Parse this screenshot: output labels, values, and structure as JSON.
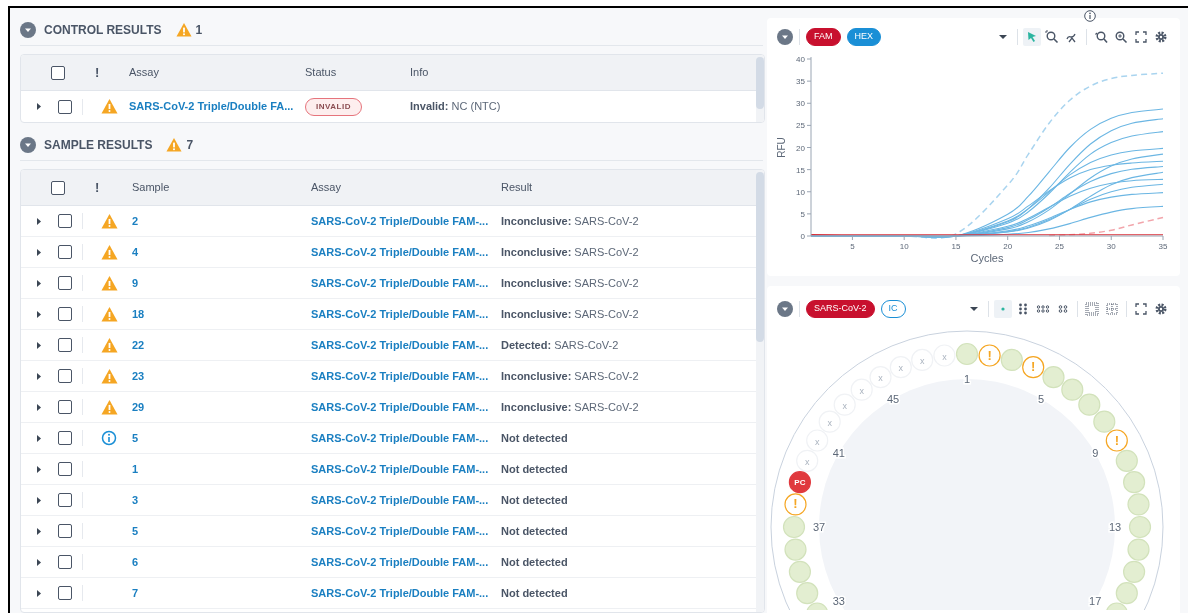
{
  "control_results": {
    "title": "CONTROL RESULTS",
    "warning_count": "1",
    "expanded": true,
    "columns": [
      "Assay",
      "Status",
      "Info"
    ],
    "flag_header": "!",
    "header_checked": false,
    "rows": [
      {
        "expanded": false,
        "checked": false,
        "kind": "warning",
        "assay": "SARS-CoV-2 Triple/Double FA...",
        "status": "INVALID",
        "info_label": "Invalid:",
        "info_detail": "NC (NTC)"
      }
    ]
  },
  "sample_results": {
    "title": "SAMPLE RESULTS",
    "warning_count": "7",
    "expanded": true,
    "columns": [
      "Sample",
      "Assay",
      "Result"
    ],
    "flag_header": "!",
    "header_checked": false,
    "rows": [
      {
        "expanded": false,
        "checked": false,
        "kind": "warning",
        "sample": "2",
        "assay": "SARS-CoV-2 Triple/Double FAM-...",
        "result_label": "Inconclusive:",
        "result_detail": "SARS-CoV-2"
      },
      {
        "expanded": false,
        "checked": false,
        "kind": "warning",
        "sample": "4",
        "assay": "SARS-CoV-2 Triple/Double FAM-...",
        "result_label": "Inconclusive:",
        "result_detail": "SARS-CoV-2"
      },
      {
        "expanded": false,
        "checked": false,
        "kind": "warning",
        "sample": "9",
        "assay": "SARS-CoV-2 Triple/Double FAM-...",
        "result_label": "Inconclusive:",
        "result_detail": "SARS-CoV-2"
      },
      {
        "expanded": false,
        "checked": false,
        "kind": "warning",
        "sample": "18",
        "assay": "SARS-CoV-2 Triple/Double FAM-...",
        "result_label": "Inconclusive:",
        "result_detail": "SARS-CoV-2"
      },
      {
        "expanded": false,
        "checked": false,
        "kind": "warning",
        "sample": "22",
        "assay": "SARS-CoV-2 Triple/Double FAM-...",
        "result_label": "Detected:",
        "result_detail": "SARS-CoV-2"
      },
      {
        "expanded": false,
        "checked": false,
        "kind": "warning",
        "sample": "23",
        "assay": "SARS-CoV-2 Triple/Double FAM-...",
        "result_label": "Inconclusive:",
        "result_detail": "SARS-CoV-2"
      },
      {
        "expanded": false,
        "checked": false,
        "kind": "warning",
        "sample": "29",
        "assay": "SARS-CoV-2 Triple/Double FAM-...",
        "result_label": "Inconclusive:",
        "result_detail": "SARS-CoV-2"
      },
      {
        "expanded": false,
        "checked": false,
        "kind": "info",
        "sample": "5",
        "assay": "SARS-CoV-2 Triple/Double FAM-...",
        "result_label": "Not detected"
      },
      {
        "expanded": false,
        "checked": false,
        "kind": "plain",
        "sample": "1",
        "assay": "SARS-CoV-2 Triple/Double FAM-...",
        "result_label": "Not detected"
      },
      {
        "expanded": false,
        "checked": false,
        "kind": "plain",
        "sample": "3",
        "assay": "SARS-CoV-2 Triple/Double FAM-...",
        "result_label": "Not detected"
      },
      {
        "expanded": false,
        "checked": false,
        "kind": "plain",
        "sample": "5",
        "assay": "SARS-CoV-2 Triple/Double FAM-...",
        "result_label": "Not detected"
      },
      {
        "expanded": false,
        "checked": false,
        "kind": "plain",
        "sample": "6",
        "assay": "SARS-CoV-2 Triple/Double FAM-...",
        "result_label": "Not detected"
      },
      {
        "expanded": false,
        "checked": false,
        "kind": "plain",
        "sample": "7",
        "assay": "SARS-CoV-2 Triple/Double FAM-...",
        "result_label": "Not detected"
      }
    ]
  },
  "amplification": {
    "expanded": true,
    "channels": [
      {
        "label": "FAM",
        "selected": true,
        "color": "#c8102e"
      },
      {
        "label": "HEX",
        "selected": true,
        "color": "#1a8fd6"
      }
    ],
    "chart_data": {
      "type": "line",
      "xlabel": "Cycles",
      "ylabel": "RFU",
      "xlim": [
        1,
        35
      ],
      "ylim": [
        0,
        40
      ],
      "xticks": [
        5,
        10,
        15,
        20,
        25,
        30,
        35
      ],
      "yticks": [
        0,
        5,
        10,
        15,
        20,
        25,
        30,
        35,
        40
      ],
      "x": [
        1,
        5,
        10,
        15,
        20,
        22,
        24,
        26,
        28,
        30,
        32,
        35
      ],
      "series": [
        {
          "color": "#a9d4ef",
          "line_style": "dashed",
          "values": [
            0,
            0,
            0,
            0.5,
            11.5,
            18.5,
            25.5,
            30.7,
            33.9,
            35.6,
            36.3,
            36.8
          ]
        },
        {
          "color": "#6bb6e3",
          "line_style": "solid",
          "values": [
            0,
            0,
            0,
            0,
            4.9,
            9.0,
            14.5,
            20.0,
            24.1,
            26.6,
            27.9,
            28.7
          ]
        },
        {
          "color": "#6bb6e3",
          "line_style": "solid",
          "values": [
            0,
            0,
            0,
            0,
            3.2,
            6.2,
            10.8,
            16.2,
            20.8,
            23.8,
            25.5,
            26.5
          ]
        },
        {
          "color": "#6bb6e3",
          "line_style": "solid",
          "values": [
            0,
            0,
            0,
            0,
            2.9,
            5.5,
            9.6,
            14.4,
            18.5,
            21.1,
            22.6,
            23.6
          ]
        },
        {
          "color": "#6bb6e3",
          "line_style": "solid",
          "values": [
            0,
            0,
            0,
            0,
            3.4,
            6.2,
            10.0,
            13.8,
            16.6,
            18.3,
            19.2,
            19.8
          ]
        },
        {
          "color": "#6bb6e3",
          "line_style": "solid",
          "values": [
            0,
            0,
            0,
            0,
            1.6,
            3.2,
            5.9,
            9.5,
            13.1,
            15.8,
            17.4,
            18.5
          ]
        },
        {
          "color": "#6bb6e3",
          "line_style": "solid",
          "values": [
            0,
            0,
            0,
            0,
            3.9,
            6.8,
            10.2,
            13.1,
            15.0,
            16.0,
            16.5,
            16.9
          ]
        },
        {
          "color": "#6bb6e3",
          "line_style": "solid",
          "values": [
            0,
            0,
            0,
            0,
            1.9,
            3.7,
            6.4,
            9.6,
            12.3,
            14.1,
            15.1,
            15.7
          ]
        },
        {
          "color": "#6bb6e3",
          "line_style": "solid",
          "values": [
            0,
            0,
            0,
            0,
            0.9,
            1.8,
            3.5,
            6.0,
            9.0,
            11.6,
            13.2,
            14.4
          ]
        },
        {
          "color": "#6bb6e3",
          "line_style": "solid",
          "values": [
            0,
            0,
            0,
            0,
            2.2,
            4.0,
            6.5,
            9.0,
            10.8,
            11.9,
            12.5,
            12.8
          ]
        },
        {
          "color": "#6bb6e3",
          "line_style": "solid",
          "values": [
            0,
            0,
            0,
            0,
            1.0,
            2.0,
            3.7,
            6.0,
            8.3,
            10.0,
            11.0,
            11.7
          ]
        },
        {
          "color": "#6bb6e3",
          "line_style": "solid",
          "values": [
            0,
            0,
            0,
            0,
            1.2,
            2.3,
            4.0,
            6.0,
            7.7,
            8.8,
            9.4,
            9.8
          ]
        },
        {
          "color": "#6bb6e3",
          "line_style": "solid",
          "values": [
            0,
            0,
            0,
            0,
            0.4,
            0.8,
            1.6,
            2.8,
            4.2,
            5.4,
            6.2,
            6.7
          ]
        },
        {
          "color": "#f2a5ab",
          "line_style": "dashed",
          "values": [
            null,
            null,
            null,
            null,
            null,
            null,
            0.1,
            0.3,
            0.6,
            1.3,
            2.5,
            4.2
          ]
        },
        {
          "color": "#d9303a",
          "line_style": "solid",
          "values": [
            0.3,
            0.3,
            0.3,
            0.3,
            0.3,
            0.3,
            0.3,
            0.3,
            0.3,
            0.3,
            0.3,
            0.3
          ]
        }
      ]
    }
  },
  "plate": {
    "expanded": true,
    "targets": [
      {
        "label": "SARS-CoV-2",
        "selected": true,
        "color": "#c8102e"
      },
      {
        "label": "IC",
        "selected": false,
        "color": "#1a8fd6"
      }
    ],
    "top_wells": [
      {
        "kind": "empty",
        "mark": "x"
      },
      {
        "kind": "empty",
        "mark": "x"
      },
      {
        "kind": "empty",
        "mark": "x",
        "label": "45"
      },
      {
        "kind": "empty",
        "mark": "x"
      },
      {
        "kind": "empty",
        "mark": "x"
      },
      {
        "kind": "empty",
        "mark": "x"
      },
      {
        "kind": "ok",
        "label": "1"
      },
      {
        "kind": "warning",
        "mark": "!"
      },
      {
        "kind": "ok"
      },
      {
        "kind": "warning",
        "mark": "!"
      },
      {
        "kind": "ok",
        "label": "5"
      },
      {
        "kind": "ok"
      },
      {
        "kind": "ok"
      }
    ],
    "left_wells": [
      {
        "kind": "empty",
        "mark": "x"
      },
      {
        "kind": "empty",
        "mark": "x",
        "label": "41"
      },
      {
        "kind": "empty",
        "mark": "x"
      },
      {
        "kind": "control",
        "mark": "PC"
      },
      {
        "kind": "warning",
        "mark": "!"
      },
      {
        "kind": "ok",
        "label": "37"
      },
      {
        "kind": "ok"
      },
      {
        "kind": "ok"
      },
      {
        "kind": "ok"
      },
      {
        "kind": "ok",
        "label": "33"
      }
    ],
    "right_wells": [
      {
        "kind": "ok"
      },
      {
        "kind": "warning",
        "mark": "!",
        "label": "9"
      },
      {
        "kind": "ok"
      },
      {
        "kind": "ok"
      },
      {
        "kind": "ok"
      },
      {
        "kind": "ok",
        "label": "13"
      },
      {
        "kind": "ok"
      },
      {
        "kind": "ok"
      },
      {
        "kind": "ok"
      },
      {
        "kind": "ok",
        "label": "17"
      }
    ]
  }
}
